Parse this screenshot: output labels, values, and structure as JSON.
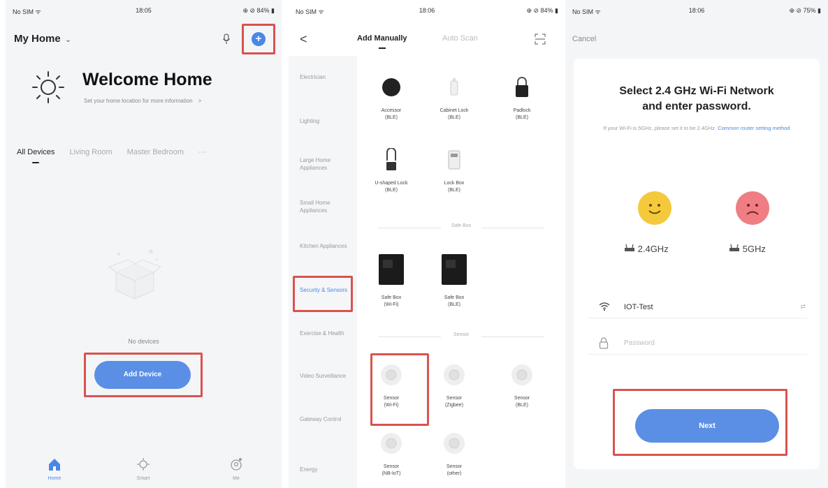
{
  "phone1": {
    "status": {
      "carrier": "No SIM ᯤ",
      "time": "18:05",
      "battery": "⊕ ⊘ 84% ▮"
    },
    "home_title": "My Home",
    "home_chevron": "⌄",
    "welcome": "Welcome Home",
    "welcome_sub": "Set your home location for more information",
    "welcome_sub_arrow": ">",
    "room_tabs": [
      "All Devices",
      "Living Room",
      "Master Bedroom"
    ],
    "room_more": "···",
    "no_devices": "No devices",
    "add_device": "Add Device",
    "tabbar": [
      {
        "label": "Home",
        "icon": "home-icon"
      },
      {
        "label": "Smart",
        "icon": "smart-icon"
      },
      {
        "label": "Me",
        "icon": "me-icon"
      }
    ]
  },
  "phone2": {
    "status": {
      "carrier": "No SIM ᯤ",
      "time": "18:06",
      "battery": "⊕ ⊘ 84% ▮"
    },
    "back": "<",
    "tab_add": "Add Manually",
    "tab_scan": "Auto Scan",
    "categories": [
      "Electrician",
      "Lighting",
      "Large Home Appliances",
      "Small Home Appliances",
      "Kitchen Appliances",
      "Security & Sensors",
      "Exercise & Health",
      "Video Surveillance",
      "Gateway Control",
      "Energy"
    ],
    "row1": [
      {
        "name": "Accessor",
        "proto": "(BLE)"
      },
      {
        "name": "Cabinet Lock",
        "proto": "(BLE)"
      },
      {
        "name": "Padlock",
        "proto": "(BLE)"
      }
    ],
    "row2": [
      {
        "name": "U-shaped Lock",
        "proto": "(BLE)"
      },
      {
        "name": "Lock Box",
        "proto": "(BLE)"
      }
    ],
    "section_safe": "Safe Box",
    "safe": [
      {
        "name": "Safe Box",
        "proto": "(Wi-Fi)"
      },
      {
        "name": "Safe Box",
        "proto": "(BLE)"
      }
    ],
    "section_sensor": "Sensor",
    "sensors": [
      {
        "name": "Sensor",
        "proto": "(Wi-Fi)"
      },
      {
        "name": "Sensor",
        "proto": "(Zigbee)"
      },
      {
        "name": "Sensor",
        "proto": "(BLE)"
      },
      {
        "name": "Sensor",
        "proto": "(NB-IoT)"
      },
      {
        "name": "Sensor",
        "proto": "(other)"
      }
    ]
  },
  "phone3": {
    "status": {
      "carrier": "No SIM ᯤ",
      "time": "18:06",
      "battery": "⊕ ⊘ 75% ▮"
    },
    "cancel": "Cancel",
    "title_line1": "Select 2.4 GHz Wi-Fi Network",
    "title_line2": "and enter password.",
    "sub_text": "If your Wi-Fi is 5GHz, please set it to be 2.4GHz.",
    "sub_link": "Common router setting method",
    "band_24": "2.4GHz",
    "band_5": "5GHz",
    "wifi_name": "IOT-Test",
    "wifi_arrow": "⇄",
    "password_placeholder": "Password",
    "next": "Next"
  },
  "colors": {
    "accent": "#4a87e8",
    "button": "#5b8fe6",
    "highlight": "#d9534f",
    "happy": "#f5c93c",
    "sad": "#ee7e84"
  }
}
